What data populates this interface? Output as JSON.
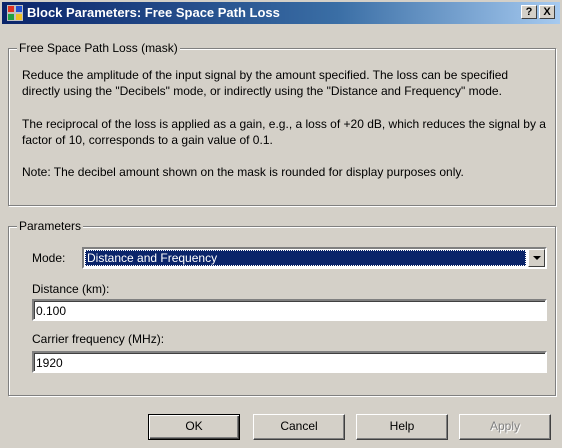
{
  "window": {
    "title": "Block Parameters: Free Space Path Loss",
    "help_glyph": "?",
    "close_glyph": "X"
  },
  "mask": {
    "legend": "Free Space Path Loss (mask)",
    "para1": "Reduce the amplitude of the input signal by the amount specified.  The loss can be specified directly using the \"Decibels\" mode, or indirectly using the \"Distance and Frequency\" mode.",
    "para2": "The reciprocal of the loss is applied as a gain, e.g., a loss of +20 dB, which reduces the signal by a factor of 10, corresponds to a gain value of 0.1.",
    "para3": "Note:  The decibel amount shown on the mask is rounded for display purposes only."
  },
  "parameters": {
    "legend": "Parameters",
    "mode_label": "Mode:",
    "mode_value": "Distance and Frequency",
    "distance_label": "Distance (km):",
    "distance_value": "0.100",
    "frequency_label": "Carrier frequency (MHz):",
    "frequency_value": "1920"
  },
  "buttons": {
    "ok": "OK",
    "cancel": "Cancel",
    "help": "Help",
    "apply": "Apply"
  }
}
